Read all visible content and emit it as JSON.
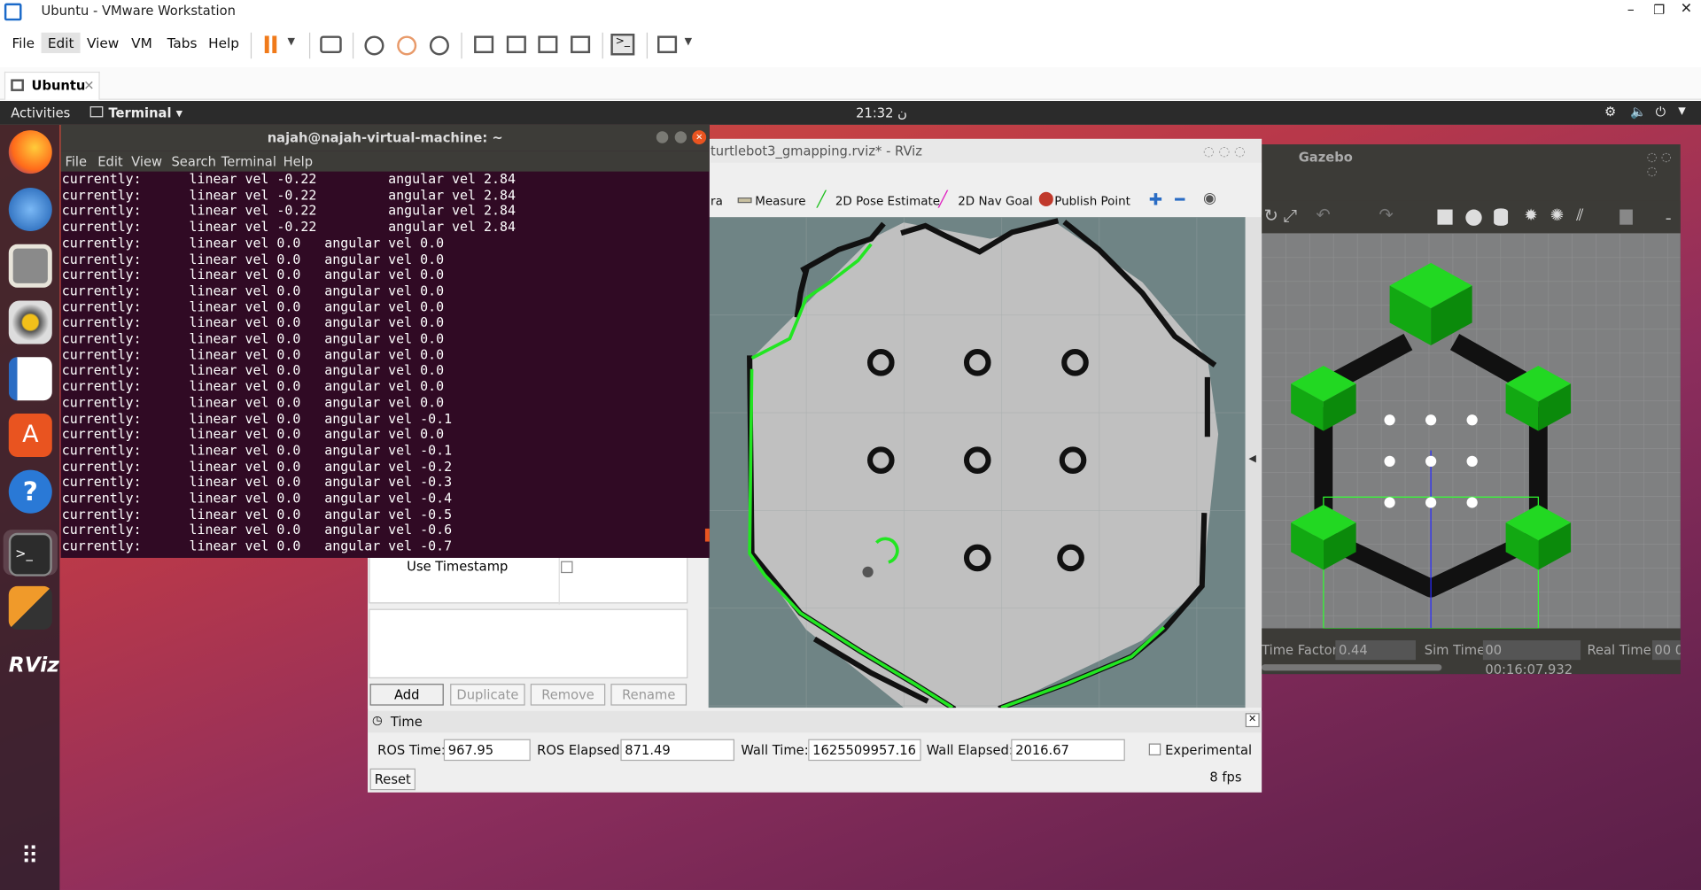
{
  "vmware": {
    "title": "Ubuntu - VMware Workstation",
    "menu": [
      "File",
      "Edit",
      "View",
      "VM",
      "Tabs",
      "Help"
    ],
    "tab": "Ubuntu"
  },
  "ubuntu": {
    "activities": "Activities",
    "app": "Terminal ▾",
    "clock": "21:32 ن"
  },
  "terminal": {
    "title": "najah@najah-virtual-machine: ~",
    "menu": [
      "File",
      "Edit",
      "View",
      "Search",
      "Terminal",
      "Help"
    ],
    "lines": [
      "currently:\tlinear vel -0.22\t angular vel 2.84",
      "currently:\tlinear vel -0.22\t angular vel 2.84",
      "currently:\tlinear vel -0.22\t angular vel 2.84",
      "currently:\tlinear vel -0.22\t angular vel 2.84",
      "currently:\tlinear vel 0.0\t angular vel 0.0",
      "currently:\tlinear vel 0.0\t angular vel 0.0",
      "currently:\tlinear vel 0.0\t angular vel 0.0",
      "currently:\tlinear vel 0.0\t angular vel 0.0",
      "currently:\tlinear vel 0.0\t angular vel 0.0",
      "currently:\tlinear vel 0.0\t angular vel 0.0",
      "currently:\tlinear vel 0.0\t angular vel 0.0",
      "currently:\tlinear vel 0.0\t angular vel 0.0",
      "currently:\tlinear vel 0.0\t angular vel 0.0",
      "currently:\tlinear vel 0.0\t angular vel 0.0",
      "currently:\tlinear vel 0.0\t angular vel 0.0",
      "currently:\tlinear vel 0.0\t angular vel -0.1",
      "currently:\tlinear vel 0.0\t angular vel 0.0",
      "currently:\tlinear vel 0.0\t angular vel -0.1",
      "currently:\tlinear vel 0.0\t angular vel -0.2",
      "currently:\tlinear vel 0.0\t angular vel -0.3",
      "currently:\tlinear vel 0.0\t angular vel -0.4",
      "currently:\tlinear vel 0.0\t angular vel -0.5",
      "currently:\tlinear vel 0.0\t angular vel -0.6",
      "currently:\tlinear vel 0.0\t angular vel -0.7"
    ]
  },
  "rviz": {
    "title": "turtlebot3_gmapping.rviz* - RViz",
    "tools": {
      "partial": "ra",
      "measure": "Measure",
      "pose": "2D Pose Estimate",
      "nav": "2D Nav Goal",
      "publish": "Publish Point"
    },
    "panel": {
      "use_timestamp": "Use Timestamp",
      "add": "Add",
      "duplicate": "Duplicate",
      "remove": "Remove",
      "rename": "Rename"
    },
    "time": {
      "header": "Time",
      "ros_time_label": "ROS Time:",
      "ros_time": "967.95",
      "ros_elapsed_label": "ROS Elapsed:",
      "ros_elapsed": "871.49",
      "wall_time_label": "Wall Time:",
      "wall_time": "1625509957.16",
      "wall_elapsed_label": "Wall Elapsed:",
      "wall_elapsed": "2016.67",
      "experimental": "Experimental",
      "reset": "Reset",
      "fps": "8 fps"
    }
  },
  "gazebo": {
    "title": "Gazebo",
    "rtf_label": "Time Factor:",
    "rtf": "0.44",
    "sim_label": "Sim Time:",
    "sim": "00 00:16:07.932",
    "real_label": "Real Time:",
    "real": "00 0"
  },
  "colors": {
    "terminal_bg": "#300a24",
    "map_free": "#c0c0c0",
    "map_unknown": "#6f8485",
    "scan": "#00ff00",
    "gazebo_green": "#19c919"
  }
}
